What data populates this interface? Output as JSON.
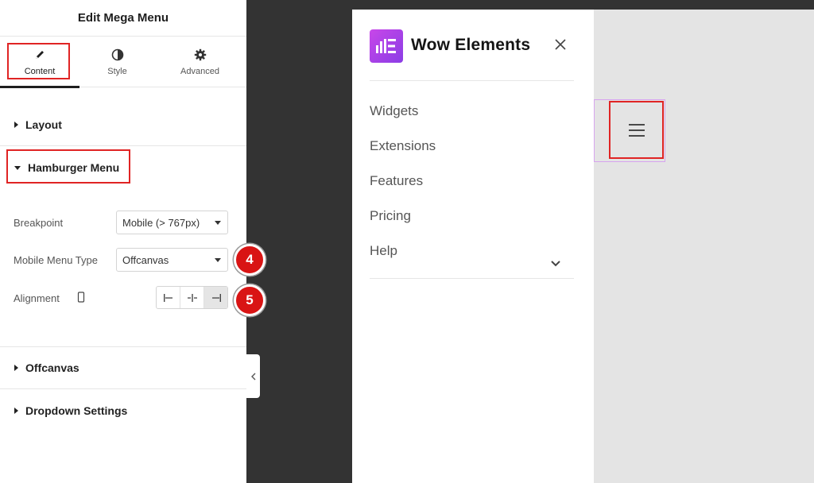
{
  "panel": {
    "title": "Edit Mega Menu",
    "tabs": [
      {
        "label": "Content",
        "icon": "pencil-icon"
      },
      {
        "label": "Style",
        "icon": "contrast-icon"
      },
      {
        "label": "Advanced",
        "icon": "gear-icon"
      }
    ],
    "sections": {
      "layout": "Layout",
      "hamburger": "Hamburger Menu",
      "offcanvas": "Offcanvas",
      "dropdown": "Dropdown Settings"
    },
    "controls": {
      "breakpoint_label": "Breakpoint",
      "breakpoint_value": "Mobile (> 767px)",
      "menu_type_label": "Mobile Menu Type",
      "menu_type_value": "Offcanvas",
      "alignment_label": "Alignment",
      "alignment_options": [
        "align-left-icon",
        "align-center-icon",
        "align-right-icon"
      ],
      "alignment_selected": "align-right-icon"
    },
    "badges": [
      "4",
      "5"
    ]
  },
  "preview": {
    "brand_name": "Wow Elements",
    "menu_items": [
      "Widgets",
      "Extensions",
      "Features",
      "Pricing",
      "Help"
    ]
  },
  "colors": {
    "accent_red": "#e02424",
    "badge_red": "#d91414",
    "logo_gradient_start": "#c847e9",
    "logo_gradient_end": "#8b3de5",
    "editor_dark": "#333333",
    "canvas_gray": "#e4e4e4"
  }
}
